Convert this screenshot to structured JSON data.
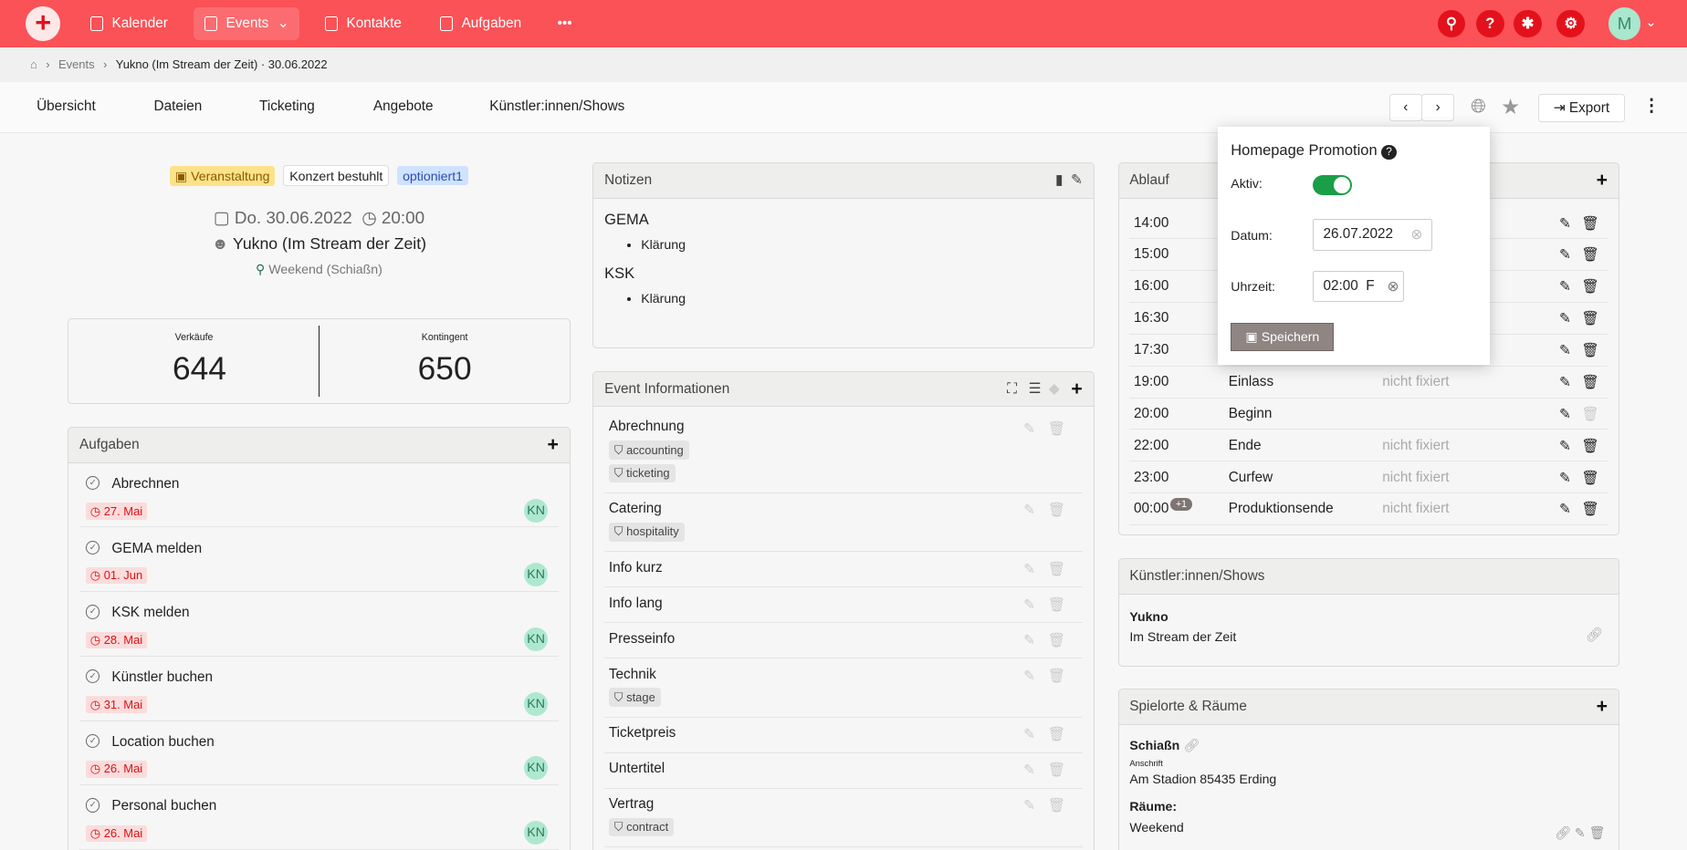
{
  "topbar": {
    "nav": [
      "Kalender",
      "Events",
      "Kontakte",
      "Aufgaben",
      "•••"
    ],
    "icons": [
      "search-icon",
      "help-icon",
      "bug-icon",
      "settings-icon"
    ],
    "avatar": "M"
  },
  "breadcrumb": [
    "Events",
    "Yukno (Im Stream der Zeit) · 30.06.2022"
  ],
  "tabs": [
    "Übersicht",
    "Dateien",
    "Ticketing",
    "Angebote",
    "Künstler:innen/Shows"
  ],
  "toolbar": {
    "export": "Export"
  },
  "event": {
    "badges": [
      "Veranstaltung",
      "Konzert bestuhlt",
      "optioniert1"
    ],
    "date": "Do. 30.06.2022",
    "time": "20:00",
    "name": "Yukno (Im Stream der Zeit)",
    "room": "Weekend (Schiaßn)"
  },
  "stats": {
    "sales_label": "Verkäufe",
    "sales": "644",
    "quota_label": "Kontingent",
    "quota": "650"
  },
  "tasks": {
    "title": "Aufgaben",
    "items": [
      {
        "t": "Abrechnen",
        "d": "27. Mai",
        "a": "KN"
      },
      {
        "t": "GEMA melden",
        "d": "01. Jun",
        "a": "KN"
      },
      {
        "t": "KSK melden",
        "d": "28. Mai",
        "a": "KN"
      },
      {
        "t": "Künstler buchen",
        "d": "31. Mai",
        "a": "KN"
      },
      {
        "t": "Location buchen",
        "d": "26. Mai",
        "a": "KN"
      },
      {
        "t": "Personal buchen",
        "d": "26. Mai",
        "a": "KN"
      }
    ]
  },
  "notes": {
    "title": "Notizen",
    "h1": "GEMA",
    "i1": "Klärung",
    "h2": "KSK",
    "i2": "Klärung"
  },
  "info": {
    "title": "Event Informationen",
    "rows": [
      {
        "n": "Abrechnung",
        "tags": [
          "accounting",
          "ticketing"
        ]
      },
      {
        "n": "Catering",
        "tags": [
          "hospitality"
        ]
      },
      {
        "n": "Info kurz",
        "tags": []
      },
      {
        "n": "Info lang",
        "tags": []
      },
      {
        "n": "Presseinfo",
        "tags": []
      },
      {
        "n": "Technik",
        "tags": [
          "stage"
        ]
      },
      {
        "n": "Ticketpreis",
        "tags": []
      },
      {
        "n": "Untertitel",
        "tags": []
      },
      {
        "n": "Vertrag",
        "tags": [
          "contract"
        ]
      }
    ]
  },
  "schedule": {
    "title": "Ablauf",
    "rows": [
      {
        "time": "14:00",
        "name": "",
        "status": ""
      },
      {
        "time": "15:00",
        "name": "",
        "status": ""
      },
      {
        "time": "16:00",
        "name": "",
        "status": ""
      },
      {
        "time": "16:30",
        "name": "",
        "status": ""
      },
      {
        "time": "17:30",
        "name": "",
        "status": ""
      },
      {
        "time": "19:00",
        "name": "Einlass",
        "status": "nicht fixiert"
      },
      {
        "time": "20:00",
        "name": "Beginn",
        "status": ""
      },
      {
        "time": "22:00",
        "name": "Ende",
        "status": "nicht fixiert"
      },
      {
        "time": "23:00",
        "name": "Curfew",
        "status": "nicht fixiert"
      },
      {
        "time": "00:00",
        "name": "Produktionsende",
        "status": "nicht fixiert",
        "badge": "+1"
      }
    ]
  },
  "artists": {
    "title": "Künstler:innen/Shows",
    "name": "Yukno",
    "show": "Im Stream der Zeit"
  },
  "venues": {
    "title": "Spielorte & Räume",
    "name": "Schiaßn",
    "addr_label": "Anschrift",
    "addr": "Am Stadion 85435 Erding",
    "rooms_label": "Räume:",
    "room": "Weekend"
  },
  "popup": {
    "title": "Homepage Promotion",
    "active_label": "Aktiv:",
    "active": true,
    "date_label": "Datum:",
    "date": "26.07.2022",
    "time_label": "Uhrzeit:",
    "time": "02:00  F",
    "save": "Speichern"
  },
  "colors": {
    "brand": "#fa5257",
    "toggle": "#1a9e48"
  }
}
